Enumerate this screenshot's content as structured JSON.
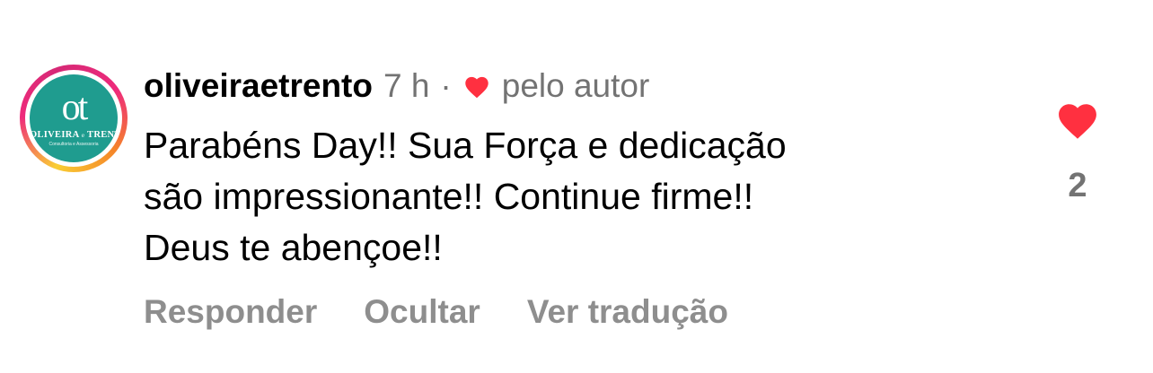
{
  "comment": {
    "avatar": {
      "monogram": "ot",
      "brand_line_1": "OLIVEIRA",
      "brand_connector": "e",
      "brand_line_2": "TRENTO",
      "tagline": "Consultoria e Assessoria",
      "color": "#1f9c8f"
    },
    "username": "oliveiraetrento",
    "time": "7 h",
    "separator": "·",
    "liked_by_author_icon": "heart-icon",
    "liked_by_author_label": "pelo autor",
    "text_lines": [
      "Parabéns Day!! Sua Força e dedicação",
      "são impressionante!! Continue firme!!",
      "Deus te abençoe!!"
    ],
    "actions": {
      "reply": "Responder",
      "hide": "Ocultar",
      "translate": "Ver tradução"
    },
    "like": {
      "icon": "heart-icon",
      "count": "2",
      "liked": true,
      "color": "#ff3040"
    }
  }
}
